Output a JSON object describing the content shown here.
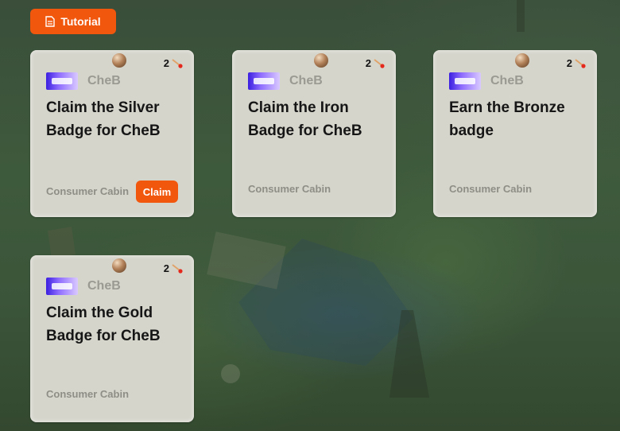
{
  "toolbar": {
    "tutorial_label": "Tutorial"
  },
  "cards": [
    {
      "brand": "CheB",
      "points": "2",
      "title": "Claim the Silver Badge for CheB",
      "org": "Consumer Cabin",
      "claim_label": "Claim"
    },
    {
      "brand": "CheB",
      "points": "2",
      "title": "Claim the Iron Badge for CheB",
      "org": "Consumer Cabin"
    },
    {
      "brand": "CheB",
      "points": "2",
      "title": "Earn the Bronze badge",
      "org": "Consumer Cabin"
    },
    {
      "brand": "CheB",
      "points": "2",
      "title": "Claim the Gold Badge for CheB",
      "org": "Consumer Cabin"
    }
  ],
  "colors": {
    "accent": "#f2570e",
    "card_bg": "#d6d5cc"
  }
}
